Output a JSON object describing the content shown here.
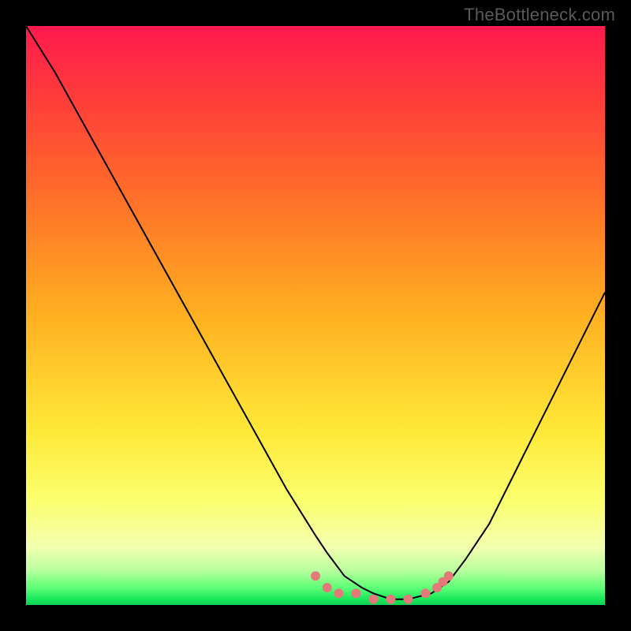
{
  "watermark": "TheBottleneck.com",
  "chart_data": {
    "type": "line",
    "title": "",
    "xlabel": "",
    "ylabel": "",
    "xlim": [
      0,
      100
    ],
    "ylim": [
      0,
      100
    ],
    "grid": false,
    "series": [
      {
        "name": "curve",
        "x": [
          0,
          5,
          10,
          15,
          20,
          25,
          30,
          35,
          40,
          45,
          50,
          52,
          55,
          58,
          60,
          63,
          66,
          70,
          73,
          76,
          80,
          84,
          88,
          92,
          96,
          100
        ],
        "values": [
          100,
          92,
          83,
          74,
          65,
          56,
          47,
          38,
          29,
          20,
          12,
          9,
          5,
          3,
          2,
          1,
          1,
          2,
          4,
          8,
          14,
          22,
          30,
          38,
          46,
          54
        ]
      }
    ],
    "markers": {
      "name": "bottom-dots",
      "x": [
        50,
        52,
        54,
        57,
        60,
        63,
        66,
        69,
        71,
        72,
        73
      ],
      "values": [
        5,
        3,
        2,
        2,
        1,
        1,
        1,
        2,
        3,
        4,
        5
      ]
    },
    "colors": {
      "curve": "#000000",
      "markers": "#e27a7a",
      "gradient_top": "#ff1a4d",
      "gradient_bottom": "#18e85a"
    }
  }
}
